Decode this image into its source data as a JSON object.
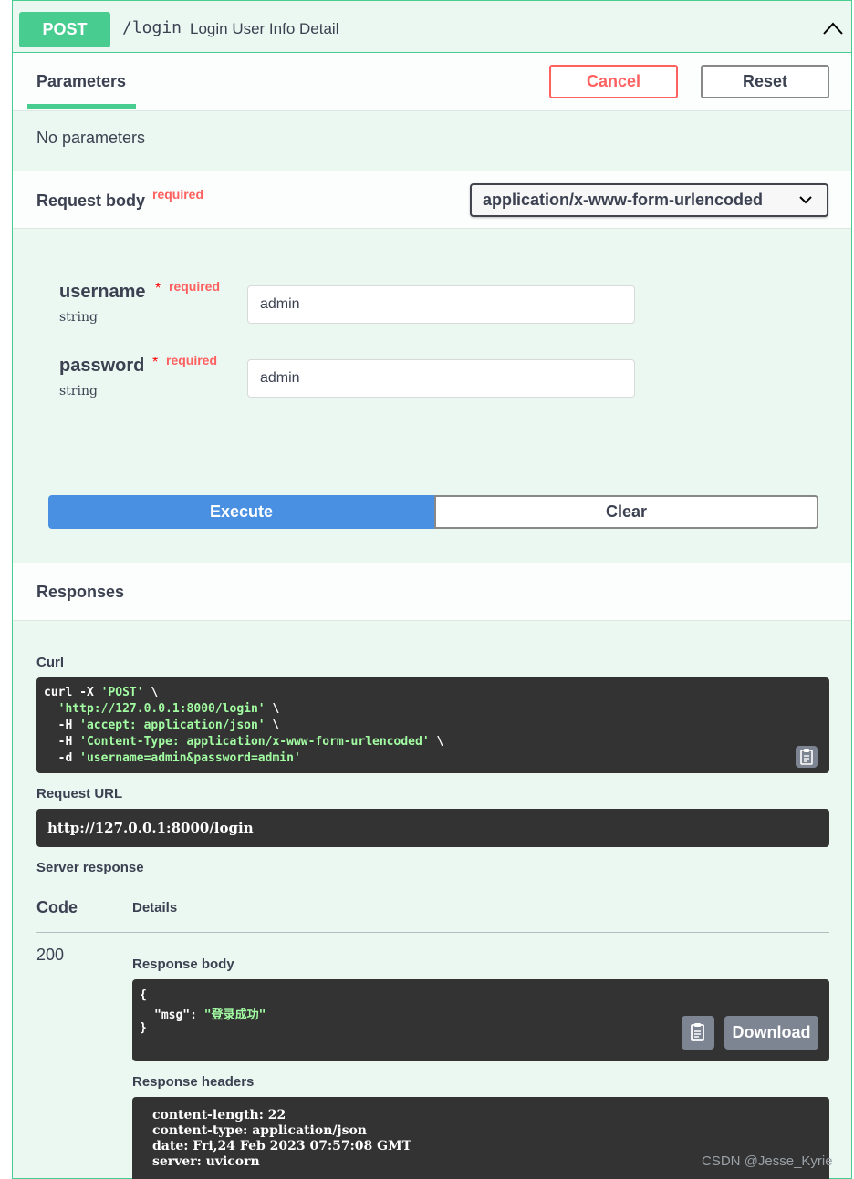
{
  "summary": {
    "method": "POST",
    "path": "/login",
    "description": "Login User Info Detail"
  },
  "parameters": {
    "tab_label": "Parameters",
    "cancel_label": "Cancel",
    "reset_label": "Reset",
    "empty_text": "No parameters"
  },
  "request_body": {
    "title": "Request body",
    "required_label": "required",
    "content_type": "application/x-www-form-urlencoded",
    "fields": [
      {
        "name": "username",
        "star": "*",
        "required": "required",
        "type": "string",
        "value": "admin"
      },
      {
        "name": "password",
        "star": "*",
        "required": "required",
        "type": "string",
        "value": "admin"
      }
    ]
  },
  "actions": {
    "execute_label": "Execute",
    "clear_label": "Clear"
  },
  "responses": {
    "title": "Responses",
    "curl_label": "Curl",
    "curl": {
      "l1_cmd": "curl -X ",
      "l1_str": "'POST'",
      "l1_end": " \\",
      "l2_str": "'http://127.0.0.1:8000/login'",
      "l2_end": " \\",
      "l3_cmd": "-H ",
      "l3_str": "'accept: application/json'",
      "l3_end": " \\",
      "l4_cmd": "-H ",
      "l4_str": "'Content-Type: application/x-www-form-urlencoded'",
      "l4_end": " \\",
      "l5_cmd": "-d ",
      "l5_str": "'username=admin&password=admin'"
    },
    "request_url_label": "Request URL",
    "request_url": "http://127.0.0.1:8000/login",
    "server_response_label": "Server response",
    "col_code": "Code",
    "col_details": "Details",
    "status": "200",
    "response_body_label": "Response body",
    "body": {
      "open": "{",
      "key": "\"msg\"",
      "colon": ": ",
      "value": "\"登录成功\"",
      "close": "}"
    },
    "download_label": "Download",
    "response_headers_label": "Response headers",
    "headers": [
      "content-length: 22",
      "content-type: application/json",
      "date: Fri,24 Feb 2023 07:57:08 GMT",
      "server: uvicorn"
    ]
  },
  "watermark": "CSDN @Jesse_Kyrie",
  "icons": {
    "collapse": "chevron-up-icon",
    "select": "chevron-down-icon",
    "copy": "clipboard-icon"
  },
  "colors": {
    "post_green": "#49cc90",
    "execute_blue": "#4990e2",
    "cancel_red": "#ff6060",
    "code_bg": "#333333",
    "code_string": "#a2fca2"
  }
}
